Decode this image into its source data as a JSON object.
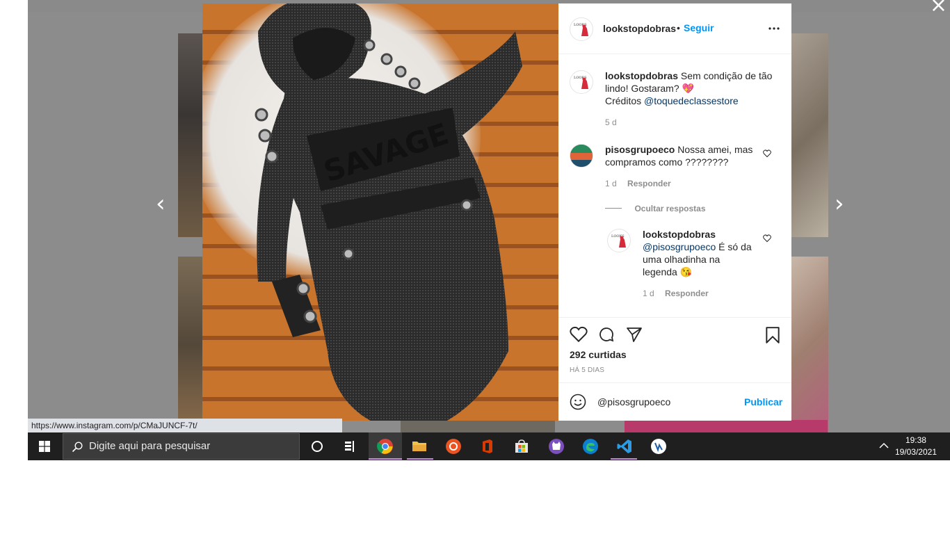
{
  "browser": {
    "status_url": "https://www.instagram.com/p/CMaJUNCF-7t/"
  },
  "post": {
    "author": "lookstopdobras",
    "follow_label": "Seguir",
    "follow_separator": "•",
    "more_icon": "more-horizontal-icon",
    "caption_author": "lookstopdobras",
    "caption_text": "Sem condição de tão lindo! Gostaram? 💖",
    "credits_label": "Créditos",
    "credits_mention": "@toquedeclassestore",
    "caption_time": "5 d",
    "likes": "292 curtidas",
    "date": "HÁ 5 DIAS"
  },
  "comments": [
    {
      "author": "pisosgrupoeco",
      "text": "Nossa amei, mas compramos como ????????",
      "time": "1 d",
      "reply_label": "Responder",
      "hide_replies_label": "Ocultar respostas"
    },
    {
      "author": "lookstopdobras",
      "mention": "@pisosgrupoeco",
      "text": "É só da uma olhadinha na legenda 😘",
      "time": "1 d",
      "reply_label": "Responder"
    }
  ],
  "comment_box": {
    "value": "@pisosgrupoeco",
    "publish_label": "Publicar"
  },
  "taskbar": {
    "search_placeholder": "Digite aqui para pesquisar",
    "time": "19:38",
    "date": "19/03/2021",
    "apps": [
      "chrome-icon",
      "file-explorer-icon",
      "ubuntu-icon",
      "office-icon",
      "store-icon",
      "cat-app-icon",
      "edge-icon",
      "vscode-icon",
      "app-icon"
    ]
  },
  "colors": {
    "accent": "#0095f6",
    "link": "#00376b",
    "taskbar": "#1f1f1f"
  }
}
